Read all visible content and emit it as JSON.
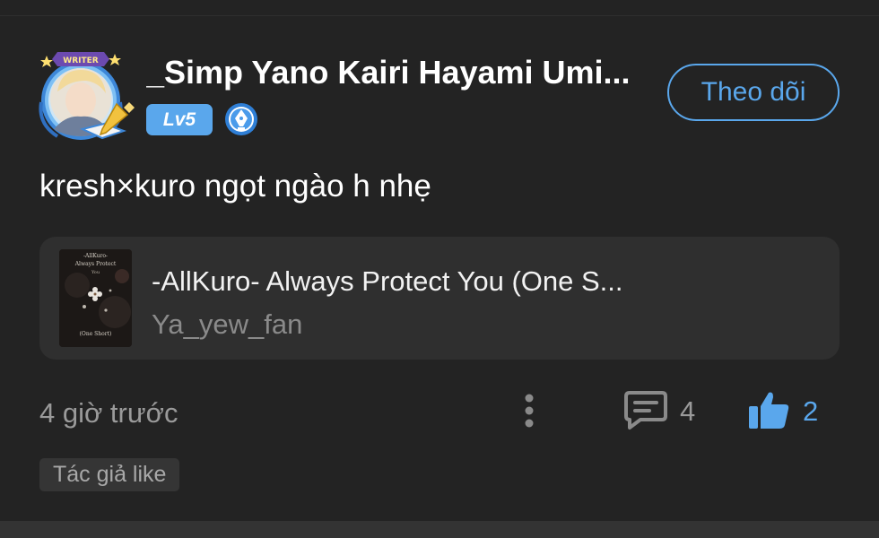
{
  "post": {
    "author": {
      "avatar_frame_label": "WRITER",
      "username": "_Simp Yano Kairi Hayami Umi...",
      "level": "Lv5"
    },
    "follow_label": "Theo dõi",
    "text": "kresh×kuro ngọt ngào h nhẹ",
    "story": {
      "title": "-AllKuro- Always Protect You (One S...",
      "author": "Ya_yew_fan",
      "cover_lines": [
        "-AllKuro-",
        "Always Protect",
        "You",
        "(One Short)"
      ]
    },
    "timestamp": "4 giờ trước",
    "comment_count": "4",
    "like_count": "2",
    "author_like_tag": "Tác giả like"
  },
  "icons": {
    "avatar_frame": "writer-avatar-frame",
    "badge": "pen-nib-badge-icon",
    "more": "more-vertical-icon",
    "comment": "comment-icon",
    "like": "thumbs-up-icon"
  },
  "colors": {
    "background": "#232323",
    "card": "#2f2f2f",
    "accent": "#5aa7ec",
    "muted_text": "#9a9a9a"
  }
}
